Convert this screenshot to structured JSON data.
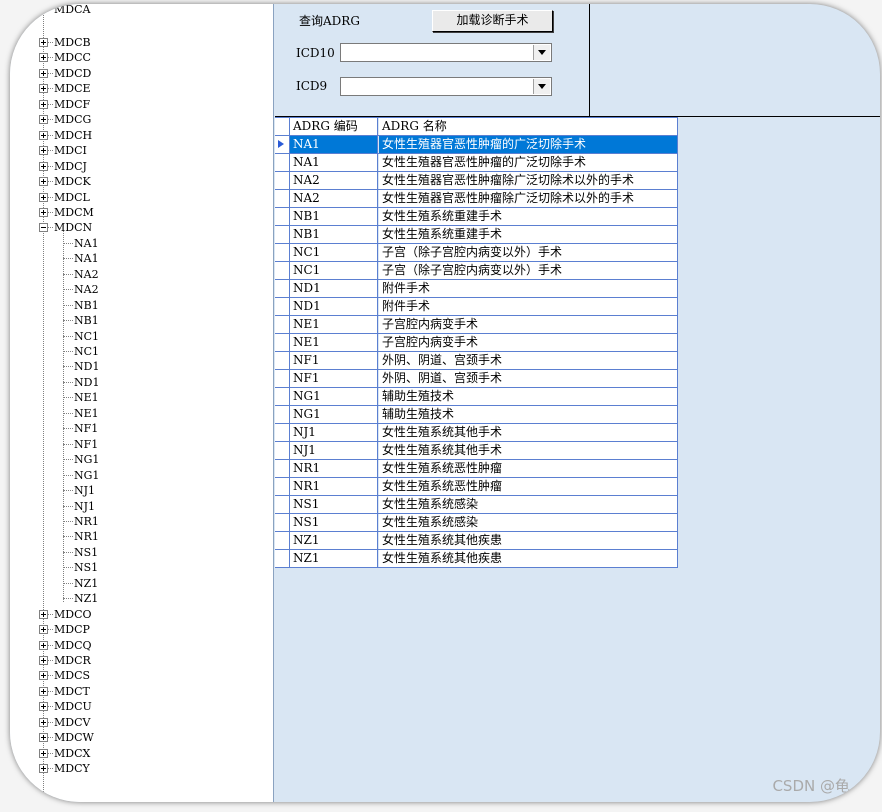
{
  "tree": {
    "top_partial": "MDCA",
    "collapsed_before": [
      "MDCB",
      "MDCC",
      "MDCD",
      "MDCE",
      "MDCF",
      "MDCG",
      "MDCH",
      "MDCI",
      "MDCJ",
      "MDCK",
      "MDCL",
      "MDCM"
    ],
    "expanded": "MDCN",
    "children": [
      "NA1",
      "NA1",
      "NA2",
      "NA2",
      "NB1",
      "NB1",
      "NC1",
      "NC1",
      "ND1",
      "ND1",
      "NE1",
      "NE1",
      "NF1",
      "NF1",
      "NG1",
      "NG1",
      "NJ1",
      "NJ1",
      "NR1",
      "NR1",
      "NS1",
      "NS1",
      "NZ1",
      "NZ1"
    ],
    "collapsed_after": [
      "MDCO",
      "MDCP",
      "MDCQ",
      "MDCR",
      "MDCS",
      "MDCT",
      "MDCU",
      "MDCV",
      "MDCW",
      "MDCX",
      "MDCY"
    ]
  },
  "form": {
    "query_label": "查询ADRG",
    "load_button": "加载诊断手术",
    "icd10_label": "ICD10",
    "icd9_label": "ICD9",
    "icd10_value": "",
    "icd9_value": ""
  },
  "grid": {
    "headers": [
      "ADRG 编码",
      "ADRG 名称"
    ],
    "rows": [
      [
        "NA1",
        "女性生殖器官恶性肿瘤的广泛切除手术"
      ],
      [
        "NA1",
        "女性生殖器官恶性肿瘤的广泛切除手术"
      ],
      [
        "NA2",
        "女性生殖器官恶性肿瘤除广泛切除术以外的手术"
      ],
      [
        "NA2",
        "女性生殖器官恶性肿瘤除广泛切除术以外的手术"
      ],
      [
        "NB1",
        "女性生殖系统重建手术"
      ],
      [
        "NB1",
        "女性生殖系统重建手术"
      ],
      [
        "NC1",
        "子宫（除子宫腔内病变以外）手术"
      ],
      [
        "NC1",
        "子宫（除子宫腔内病变以外）手术"
      ],
      [
        "ND1",
        "附件手术"
      ],
      [
        "ND1",
        "附件手术"
      ],
      [
        "NE1",
        "子宫腔内病变手术"
      ],
      [
        "NE1",
        "子宫腔内病变手术"
      ],
      [
        "NF1",
        "外阴、阴道、宫颈手术"
      ],
      [
        "NF1",
        "外阴、阴道、宫颈手术"
      ],
      [
        "NG1",
        "辅助生殖技术"
      ],
      [
        "NG1",
        "辅助生殖技术"
      ],
      [
        "NJ1",
        "女性生殖系统其他手术"
      ],
      [
        "NJ1",
        "女性生殖系统其他手术"
      ],
      [
        "NR1",
        "女性生殖系统恶性肿瘤"
      ],
      [
        "NR1",
        "女性生殖系统恶性肿瘤"
      ],
      [
        "NS1",
        "女性生殖系统感染"
      ],
      [
        "NS1",
        "女性生殖系统感染"
      ],
      [
        "NZ1",
        "女性生殖系统其他疾患"
      ],
      [
        "NZ1",
        "女性生殖系统其他疾患"
      ]
    ],
    "selected_index": 0
  },
  "watermark": "CSDN @龟"
}
